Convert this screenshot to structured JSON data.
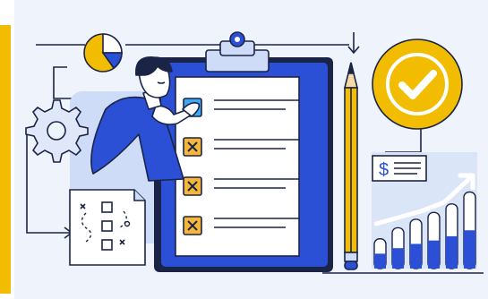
{
  "illustration": {
    "subject": "checklist-review",
    "colors": {
      "background": "#eef3fc",
      "accent_yellow": "#f2bd00",
      "primary_blue": "#2b50d6",
      "dark_navy": "#1b2447",
      "light_blue": "#cfdcf7",
      "mid_blue": "#9fb7ee",
      "check_blue": "#3fa8f4",
      "cross_orange": "#f5b63a",
      "white": "#ffffff"
    },
    "icons": {
      "chart": "pie-chart-icon",
      "gear": "gear-icon",
      "approval": "checkmark-badge-icon",
      "pencil": "pencil-icon",
      "money": "dollar-card-icon",
      "plan": "tactics-plan-icon"
    },
    "receipt": {
      "symbol": "$"
    },
    "checklist": {
      "items": [
        {
          "state": "checked"
        },
        {
          "state": "crossed"
        },
        {
          "state": "crossed"
        },
        {
          "state": "crossed"
        }
      ]
    },
    "bar_chart": {
      "levels": [
        0.35,
        0.48,
        0.58,
        0.66,
        0.76,
        0.9
      ]
    }
  }
}
